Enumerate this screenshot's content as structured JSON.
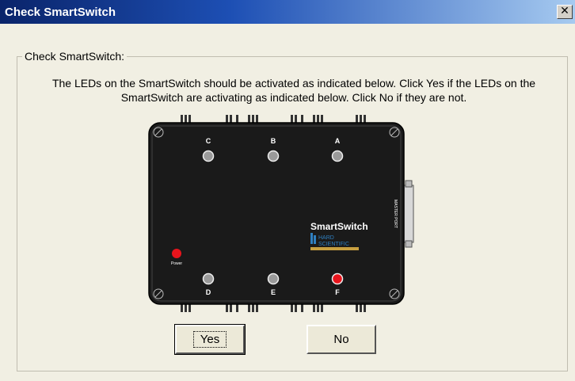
{
  "window": {
    "title": "Check SmartSwitch",
    "close_label": "✕"
  },
  "group": {
    "label": "Check SmartSwitch:"
  },
  "instructions": "The LEDs on the SmartSwitch should be activated as indicated below. Click Yes if the LEDs on the SmartSwitch are activating as indicated below. Click No if they are not.",
  "device": {
    "leds": [
      {
        "label": "C",
        "state": "off"
      },
      {
        "label": "B",
        "state": "off"
      },
      {
        "label": "A",
        "state": "off"
      },
      {
        "label": "D",
        "state": "off"
      },
      {
        "label": "E",
        "state": "off"
      },
      {
        "label": "F",
        "state": "on"
      }
    ],
    "power_label": "Power",
    "power_state": "on",
    "brand": "SmartSwitch",
    "logo_line1": "HARD",
    "logo_line2": "SCIENTIFIC",
    "port_label": "MASTER PORT",
    "colors": {
      "led_on": "#e8141c",
      "led_off": "#9a9a9a",
      "body": "#1a1a1a",
      "logo_gold": "#c8a040",
      "logo_blue": "#2f7fc0"
    }
  },
  "buttons": {
    "yes_label": "Yes",
    "no_label": "No"
  }
}
